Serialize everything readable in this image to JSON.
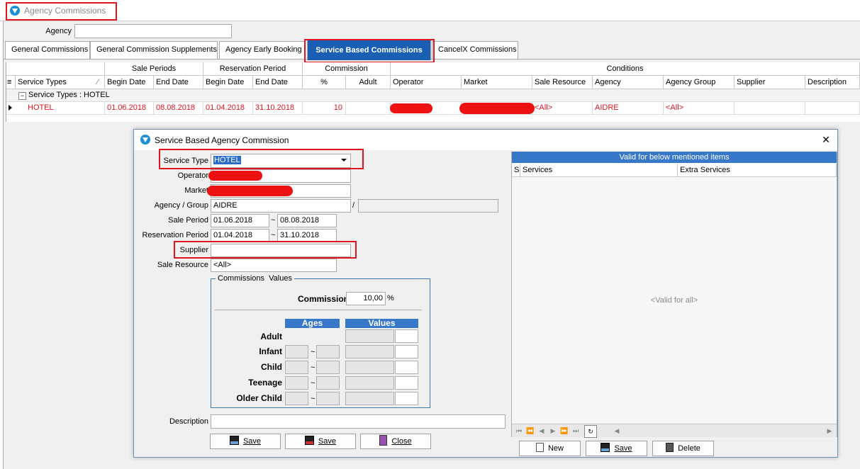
{
  "window": {
    "title": "Agency Commissions"
  },
  "agency_filter": {
    "label": "Agency",
    "value": ""
  },
  "tabs": [
    {
      "label": "General Commissions"
    },
    {
      "label": "General Commission Supplements"
    },
    {
      "label": "Agency Early Booking"
    },
    {
      "label": "Service Based Commissions"
    },
    {
      "label": "CancelX Commissions"
    }
  ],
  "grid": {
    "band_headers": {
      "sale_periods": "Sale Periods",
      "reservation_period": "Reservation Period",
      "commission": "Commission",
      "conditions": "Conditions"
    },
    "columns": {
      "service_types": "Service Types",
      "sale_begin": "Begin Date",
      "sale_end": "End Date",
      "res_begin": "Begin Date",
      "res_end": "End Date",
      "percent": "%",
      "adult": "Adult",
      "operator": "Operator",
      "market": "Market",
      "sale_resource": "Sale Resource",
      "agency": "Agency",
      "agency_group": "Agency Group",
      "supplier": "Supplier",
      "description": "Description"
    },
    "group_row": "Service Types : HOTEL",
    "row": {
      "service_type": "HOTEL",
      "sale_begin": "01.06.2018",
      "sale_end": "08.08.2018",
      "res_begin": "01.04.2018",
      "res_end": "31.10.2018",
      "percent": "10",
      "sale_resource": "<All>",
      "agency": "AIDRE",
      "agency_group": "<All>"
    }
  },
  "dialog": {
    "title": "Service Based Agency Commission",
    "close_glyph": "✕",
    "fields": {
      "service_type_label": "Service Type",
      "service_type_value": "HOTEL",
      "operator_label": "Operator",
      "market_label": "Market",
      "agency_group_label": "Agency / Group",
      "agency_value": "AIDRE",
      "slash": "/",
      "sale_period_label": "Sale Period",
      "sale_from": "01.06.2018",
      "sale_to": "08.08.2018",
      "res_period_label": "Reservation Period",
      "res_from": "01.04.2018",
      "res_to": "31.10.2018",
      "tilde": "~",
      "supplier_label": "Supplier",
      "supplier_value": "",
      "sale_resource_label": "Sale Resource",
      "sale_resource_value": "<All>",
      "description_label": "Description",
      "description_value": ""
    },
    "commission_values": {
      "group_title": "Commissions  Values",
      "commission_label": "Commission",
      "commission_value": "10,00",
      "percent_sign": "%",
      "ages_header": "Ages",
      "values_header": "Values",
      "rows": [
        "Adult",
        "Infant",
        "Child",
        "Teenage",
        "Older Child"
      ]
    },
    "buttons": {
      "save1": "Save",
      "save2": "Save",
      "close": "Close"
    },
    "valid_panel": {
      "title": "Valid for below mentioned items",
      "col_services": "Services",
      "col_extra": "Extra Services",
      "empty_text": "<Valid for all>",
      "new_label": "New",
      "save_label": "Save",
      "delete_label": "Delete"
    }
  }
}
